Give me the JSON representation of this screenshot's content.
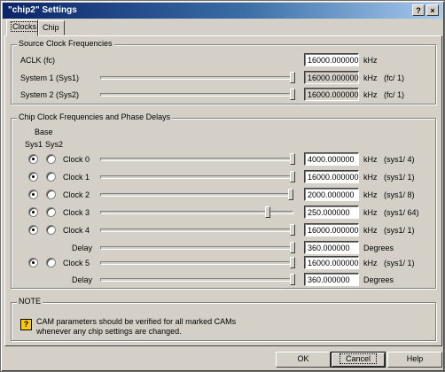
{
  "window": {
    "title": "\"chip2\" Settings",
    "help_glyph": "?",
    "close_glyph": "×"
  },
  "tabs": [
    {
      "label": "Clocks"
    },
    {
      "label": "Chip"
    }
  ],
  "source": {
    "title": "Source Clock Frequencies",
    "rows": [
      {
        "label": "ACLK (fc)",
        "value": "16000.000000",
        "unit": "kHz",
        "ratio": ""
      },
      {
        "label": "System 1 (Sys1)",
        "value": "16000.000000",
        "unit": "kHz",
        "ratio": "(fc/ 1)",
        "slider_pct": 100
      },
      {
        "label": "System 2 (Sys2)",
        "value": "16000.000000",
        "unit": "kHz",
        "ratio": "(fc/ 1)",
        "slider_pct": 100
      }
    ]
  },
  "chip": {
    "title": "Chip Clock Frequencies and Phase Delays",
    "header_base": "Base",
    "header_sys1": "Sys1",
    "header_sys2": "Sys2",
    "rows": [
      {
        "label": "Clock 0",
        "value": "4000.000000",
        "unit": "kHz",
        "ratio": "(sys1/ 4)",
        "slider_pct": 100,
        "sys1_selected": true
      },
      {
        "label": "Clock 1",
        "value": "16000.000000",
        "unit": "kHz",
        "ratio": "(sys1/ 1)",
        "slider_pct": 100,
        "sys1_selected": true
      },
      {
        "label": "Clock 2",
        "value": "2000.000000",
        "unit": "kHz",
        "ratio": "(sys1/ 8)",
        "slider_pct": 99,
        "sys1_selected": true
      },
      {
        "label": "Clock 3",
        "value": "250.000000",
        "unit": "kHz",
        "ratio": "(sys1/ 64)",
        "slider_pct": 87,
        "sys1_selected": true
      },
      {
        "label": "Clock 4",
        "value": "16000.000000",
        "unit": "kHz",
        "ratio": "(sys1/ 1)",
        "slider_pct": 100,
        "sys1_selected": true
      },
      {
        "label": "Delay",
        "value": "360.000000",
        "unit": "Degrees",
        "ratio": "",
        "slider_pct": 100
      },
      {
        "label": "Clock 5",
        "value": "16000.000000",
        "unit": "kHz",
        "ratio": "(sys1/ 1)",
        "slider_pct": 100,
        "sys1_selected": true
      },
      {
        "label": "Delay",
        "value": "360.000000",
        "unit": "Degrees",
        "ratio": "",
        "slider_pct": 100
      }
    ]
  },
  "note": {
    "title": "NOTE",
    "icon_glyph": "?",
    "line1": "CAM parameters should be verified for all marked CAMs",
    "line2": "whenever any chip settings are changed."
  },
  "buttons": {
    "ok": "OK",
    "cancel": "Cancel",
    "help": "Help"
  }
}
